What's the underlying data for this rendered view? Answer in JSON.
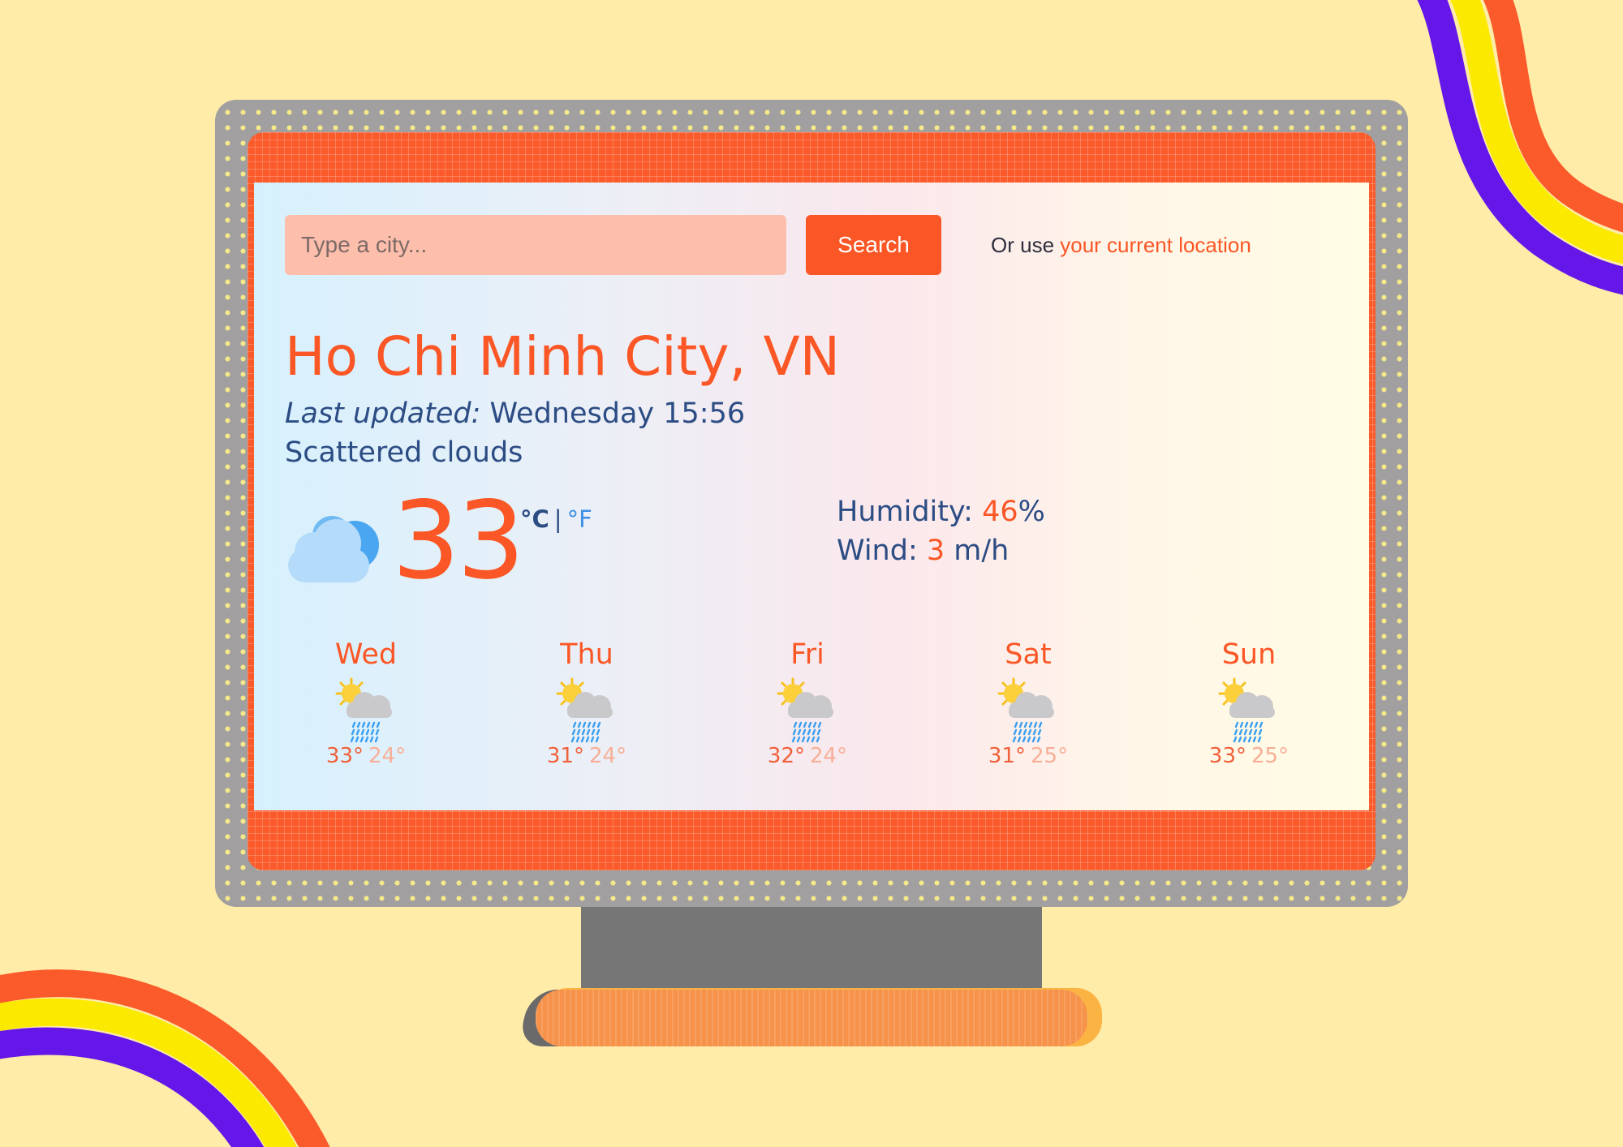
{
  "search": {
    "placeholder": "Type a city...",
    "button_label": "Search",
    "location_prefix": "Or use ",
    "location_link": "your current location"
  },
  "current": {
    "city": "Ho Chi Minh City, VN",
    "updated_label": "Last updated:",
    "updated_value": " Wednesday 15:56",
    "description": "Scattered clouds",
    "icon": "cloud-icon",
    "temperature": "33",
    "unit_celsius": "°C",
    "unit_separator": "|",
    "unit_fahrenheit": "°F",
    "humidity_label": "Humidity: ",
    "humidity_value": "46",
    "humidity_unit": "%",
    "wind_label": "Wind: ",
    "wind_value": "3",
    "wind_unit": " m/h"
  },
  "forecast": [
    {
      "day": "Wed",
      "max": "33°",
      "min": "24°",
      "icon": "sun-cloud-rain-icon"
    },
    {
      "day": "Thu",
      "max": "31°",
      "min": "24°",
      "icon": "sun-cloud-rain-icon"
    },
    {
      "day": "Fri",
      "max": "32°",
      "min": "24°",
      "icon": "sun-cloud-rain-icon"
    },
    {
      "day": "Sat",
      "max": "31°",
      "min": "25°",
      "icon": "sun-cloud-rain-icon"
    },
    {
      "day": "Sun",
      "max": "33°",
      "min": "25°",
      "icon": "sun-cloud-rain-icon"
    }
  ],
  "colors": {
    "accent": "#fb5625",
    "text": "#2c4c84",
    "background": "#ffeca8",
    "bezel": "#fb5a2a",
    "monitor_frame": "#a19f9f"
  }
}
